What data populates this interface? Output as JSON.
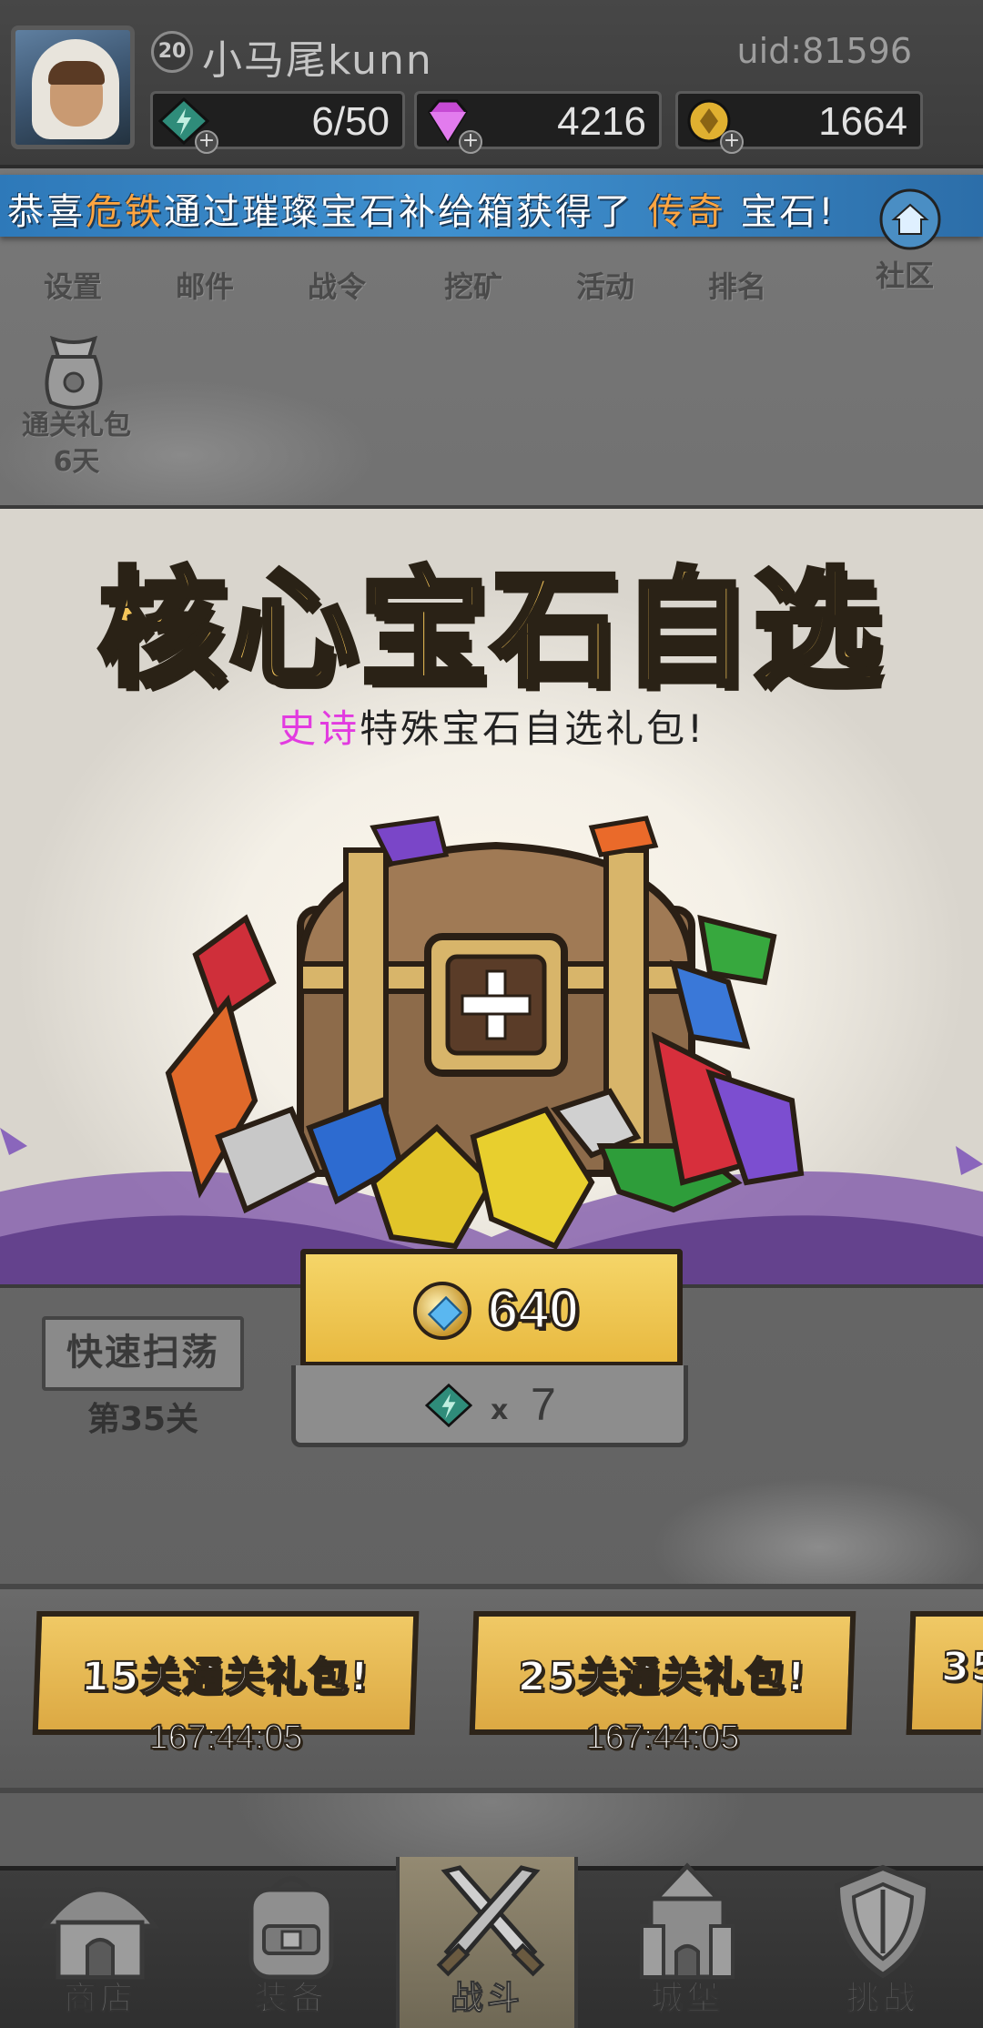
{
  "header": {
    "level": "20",
    "username": "小马尾kunn",
    "uid": "uid:81596",
    "resources": [
      {
        "icon": "energy-icon",
        "value": "6/50",
        "color": "#2f8c7a"
      },
      {
        "icon": "diamond-icon",
        "value": "4216",
        "color": "#c64ad4"
      },
      {
        "icon": "gold-coin-icon",
        "value": "1664",
        "color": "#e0b030"
      }
    ]
  },
  "notice": {
    "prefix": "恭喜",
    "player": "危铁",
    "middle": "通过璀璨宝石补给箱获得了",
    "item": "传奇",
    "suffix": "宝石!"
  },
  "menu": {
    "items": [
      "设置",
      "邮件",
      "战令",
      "挖矿",
      "活动",
      "排名"
    ],
    "community": "社区"
  },
  "gift_bag": {
    "label": "通关礼包",
    "days": "6天"
  },
  "offer": {
    "title": "核心宝石自选",
    "subtitle_highlight": "史诗",
    "subtitle_rest": "特殊宝石自选礼包!",
    "price": "640",
    "cost_prefix": "x",
    "cost_count": "7"
  },
  "sweep": {
    "button": "快速扫荡",
    "stage": "第35关"
  },
  "cards": [
    {
      "title": "15关通关礼包!",
      "timer": "167:44:05"
    },
    {
      "title": "25关通关礼包!",
      "timer": "167:44:05"
    },
    {
      "title": "35"
    }
  ],
  "nav": {
    "items": [
      "商店",
      "装备",
      "战斗",
      "城堡",
      "挑战"
    ],
    "active": "战斗"
  },
  "colors": {
    "notice_blue": "#3f90cf",
    "highlight_orange": "#ffa540",
    "epic_magenta": "#e23be0",
    "gold_button": "#f0c965"
  }
}
